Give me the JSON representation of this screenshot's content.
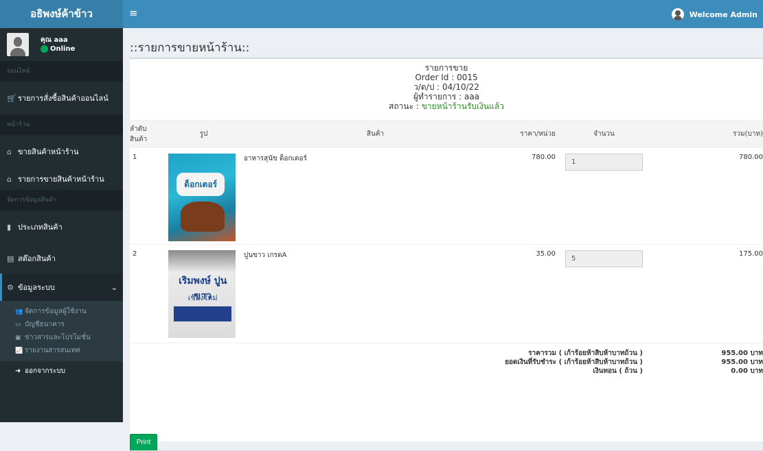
{
  "app": {
    "logo": "อธิพงษ์ค้าข้าว",
    "welcome": "Welcome Admin"
  },
  "sidebar": {
    "user_name": "คุณ aaa",
    "user_status": "Online",
    "section_online": "ออนไลน์",
    "item_online_orders": "รายการสั่งซื้อสินค้าออนไลน์",
    "section_store": "หน้าร้าน",
    "item_store_sell": "ขายสินค้าหน้าร้าน",
    "item_store_sales": "รายการขายสินค้าหน้าร้าน",
    "section_manage": "จัดการข้อมูลสินค้า",
    "item_product_type": "ประเภทสินค้า",
    "item_stock": "สต๊อกสินค้า",
    "item_system": "ข้อมูลระบบ",
    "sub_users": "จัดการข้อมูลผู้ใช้งาน",
    "sub_bank": "บัญชีธนาคาร",
    "sub_news": "ข่าวสารและโปรโมชั่น",
    "sub_report": "รายงานสารสนเทศ",
    "logout": "ออกจากระบบ"
  },
  "page": {
    "title": "::รายการขายหน้าร้าน::"
  },
  "order": {
    "heading": "รายการขาย",
    "order_id": "Order Id : 0015",
    "date": "ว/ด/ป : 04/10/22",
    "operator": "ผู้ทำรายการ : aaa",
    "status_label": "สถานะ : ",
    "status_value": "ขายหน้าร้านรับเงินแล้ว"
  },
  "table": {
    "headers": {
      "no": "ลำดับ สินค้า",
      "image": "รูป",
      "product": "สินค้า",
      "price": "ราคา/หน่วย",
      "qty": "จำนวน",
      "total": "รวม(บาท)"
    },
    "rows": [
      {
        "no": "1",
        "name": "อาหารสุนัข ด็อกเตอร์",
        "price": "780.00",
        "qty": "1",
        "total": "780.00",
        "image_text": "ด็อกเตอร์"
      },
      {
        "no": "2",
        "name": "ปูนขาว เกรดA",
        "price": "35.00",
        "qty": "5",
        "total": "175.00",
        "image_text1": "เริมพงษ์ ปูนขาว",
        "image_text2": "เชียงใหม่"
      }
    ],
    "summary": {
      "total_label": "ราคารวม ( เก้าร้อยห้าสิบห้าบาทถ้วน )",
      "paid_label": "ยอดเงินที่รับชำระ ( เก้าร้อยห้าสิบห้าบาทถ้วน )",
      "change_label": "เงินทอน ( ถ้วน )",
      "total_value": "955.00 บาท",
      "paid_value": "955.00 บาท",
      "change_value": "0.00 บาท"
    }
  },
  "actions": {
    "print": "Print"
  },
  "colors": {
    "header": "#3c8dbc",
    "sidebar": "#222d32",
    "status_green": "#2e8b22",
    "print_button": "#00a65a"
  }
}
